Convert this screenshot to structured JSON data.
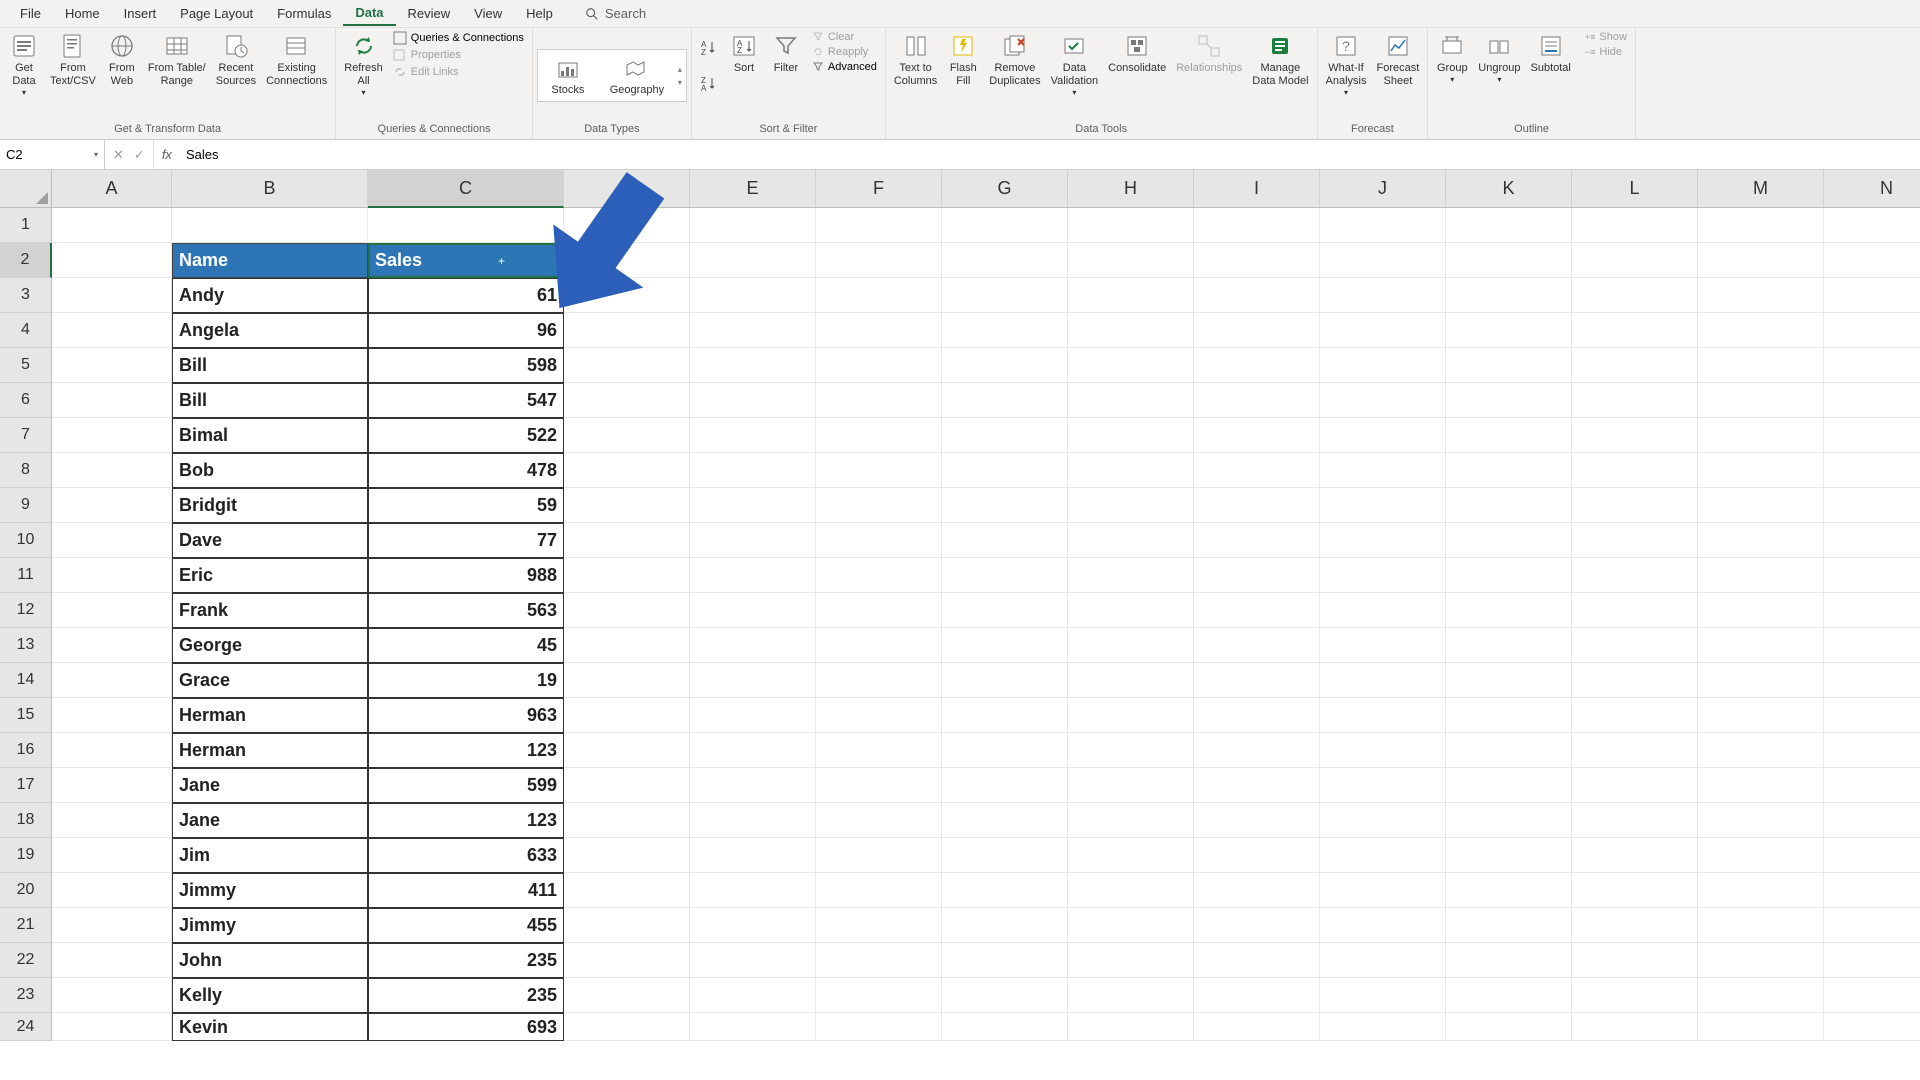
{
  "tabs": {
    "file": "File",
    "home": "Home",
    "insert": "Insert",
    "page_layout": "Page Layout",
    "formulas": "Formulas",
    "data": "Data",
    "review": "Review",
    "view": "View",
    "help": "Help"
  },
  "search_placeholder": "Search",
  "ribbon": {
    "get_transform": {
      "label": "Get & Transform Data",
      "get_data": "Get\nData",
      "from_text": "From\nText/CSV",
      "from_web": "From\nWeb",
      "from_table": "From Table/\nRange",
      "recent": "Recent\nSources",
      "existing": "Existing\nConnections"
    },
    "queries": {
      "label": "Queries & Connections",
      "refresh": "Refresh\nAll",
      "qc": "Queries & Connections",
      "props": "Properties",
      "edit_links": "Edit Links"
    },
    "data_types": {
      "label": "Data Types",
      "stocks": "Stocks",
      "geo": "Geography"
    },
    "sort_filter": {
      "label": "Sort & Filter",
      "az": "A→Z",
      "za": "Z→A",
      "sort": "Sort",
      "filter": "Filter",
      "clear": "Clear",
      "reapply": "Reapply",
      "advanced": "Advanced"
    },
    "data_tools": {
      "label": "Data Tools",
      "ttc": "Text to\nColumns",
      "flash": "Flash\nFill",
      "dups": "Remove\nDuplicates",
      "valid": "Data\nValidation",
      "consol": "Consolidate",
      "rel": "Relationships",
      "model": "Manage\nData Model"
    },
    "forecast": {
      "label": "Forecast",
      "whatif": "What-If\nAnalysis",
      "fsheet": "Forecast\nSheet"
    },
    "outline": {
      "label": "Outline",
      "group": "Group",
      "ungroup": "Ungroup",
      "subtotal": "Subtotal",
      "show": "Show",
      "hide": "Hide"
    }
  },
  "formula_bar": {
    "name_box": "C2",
    "value": "Sales"
  },
  "columns": [
    "A",
    "B",
    "C",
    "D",
    "E",
    "F",
    "G",
    "H",
    "I",
    "J",
    "K",
    "L",
    "M",
    "N"
  ],
  "col_widths": [
    "wA",
    "wB",
    "wC",
    "wD",
    "wE",
    "wF",
    "wG",
    "wH",
    "wI",
    "wJ",
    "wK",
    "wL",
    "wM",
    "wN"
  ],
  "rows": [
    "1",
    "2",
    "3",
    "4",
    "5",
    "6",
    "7",
    "8",
    "9",
    "10",
    "11",
    "12",
    "13",
    "14",
    "15",
    "16",
    "17",
    "18",
    "19",
    "20",
    "21",
    "22",
    "23",
    "24"
  ],
  "table": {
    "header_b": "Name",
    "header_c": "Sales",
    "data": [
      {
        "b": "Andy",
        "c": "61"
      },
      {
        "b": "Angela",
        "c": "96"
      },
      {
        "b": "Bill",
        "c": "598"
      },
      {
        "b": "Bill",
        "c": "547"
      },
      {
        "b": "Bimal",
        "c": "522"
      },
      {
        "b": "Bob",
        "c": "478"
      },
      {
        "b": "Bridgit",
        "c": "59"
      },
      {
        "b": "Dave",
        "c": "77"
      },
      {
        "b": "Eric",
        "c": "988"
      },
      {
        "b": "Frank",
        "c": "563"
      },
      {
        "b": "George",
        "c": "45"
      },
      {
        "b": "Grace",
        "c": "19"
      },
      {
        "b": "Herman",
        "c": "963"
      },
      {
        "b": "Herman",
        "c": "123"
      },
      {
        "b": "Jane",
        "c": "599"
      },
      {
        "b": "Jane",
        "c": "123"
      },
      {
        "b": "Jim",
        "c": "633"
      },
      {
        "b": "Jimmy",
        "c": "411"
      },
      {
        "b": "Jimmy",
        "c": "455"
      },
      {
        "b": "John",
        "c": "235"
      },
      {
        "b": "Kelly",
        "c": "235"
      },
      {
        "b": "Kevin",
        "c": "693"
      }
    ]
  },
  "selected_cell": "C2",
  "selected_row": 2,
  "selected_col": "C"
}
